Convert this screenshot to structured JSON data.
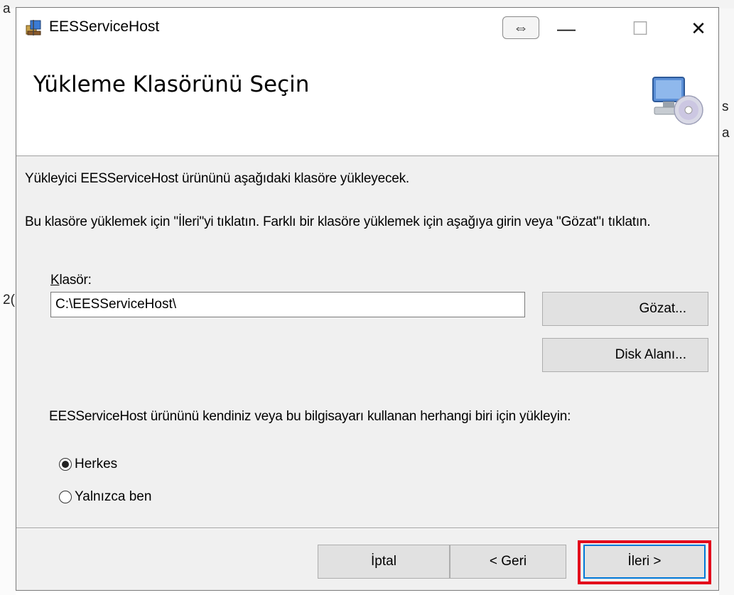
{
  "background": {
    "left_fragment_top": "a",
    "left_fragment_mid": "2(",
    "right_fragment_1": "s",
    "right_fragment_2": "a"
  },
  "window": {
    "title": "EESServiceHost",
    "resize_glyph": "⇔",
    "minimize_glyph": "—",
    "maximize_glyph": "☐",
    "close_glyph": "✕"
  },
  "header": {
    "title": "Yükleme Klasörünü Seçin",
    "icon": "computer-cd-icon"
  },
  "content": {
    "intro": "Yükleyici EESServiceHost ürününü aşağıdaki klasöre yükleyecek.",
    "instruction": "Bu klasöre yüklemek için \"İleri\"yi tıklatın. Farklı bir klasöre yüklemek için aşağıya girin veya \"Gözat\"ı tıklatın.",
    "folder_label_accel": "K",
    "folder_label_rest": "lasör:",
    "folder_value": "C:\\EESServiceHost\\",
    "browse_label": "Gözat...",
    "disk_label": "Disk Alanı...",
    "install_for": "EESServiceHost ürününü kendiniz veya bu bilgisayarı kullanan herhangi biri için yükleyin:",
    "radio_everyone": "Herkes",
    "radio_only_me": "Yalnızca ben",
    "selected_option": "Herkes"
  },
  "footer": {
    "cancel_label": "İptal",
    "back_label": "< Geri",
    "next_label": "İleri >"
  },
  "colors": {
    "highlight": "#e3001b",
    "focus_border": "#0078d7"
  }
}
